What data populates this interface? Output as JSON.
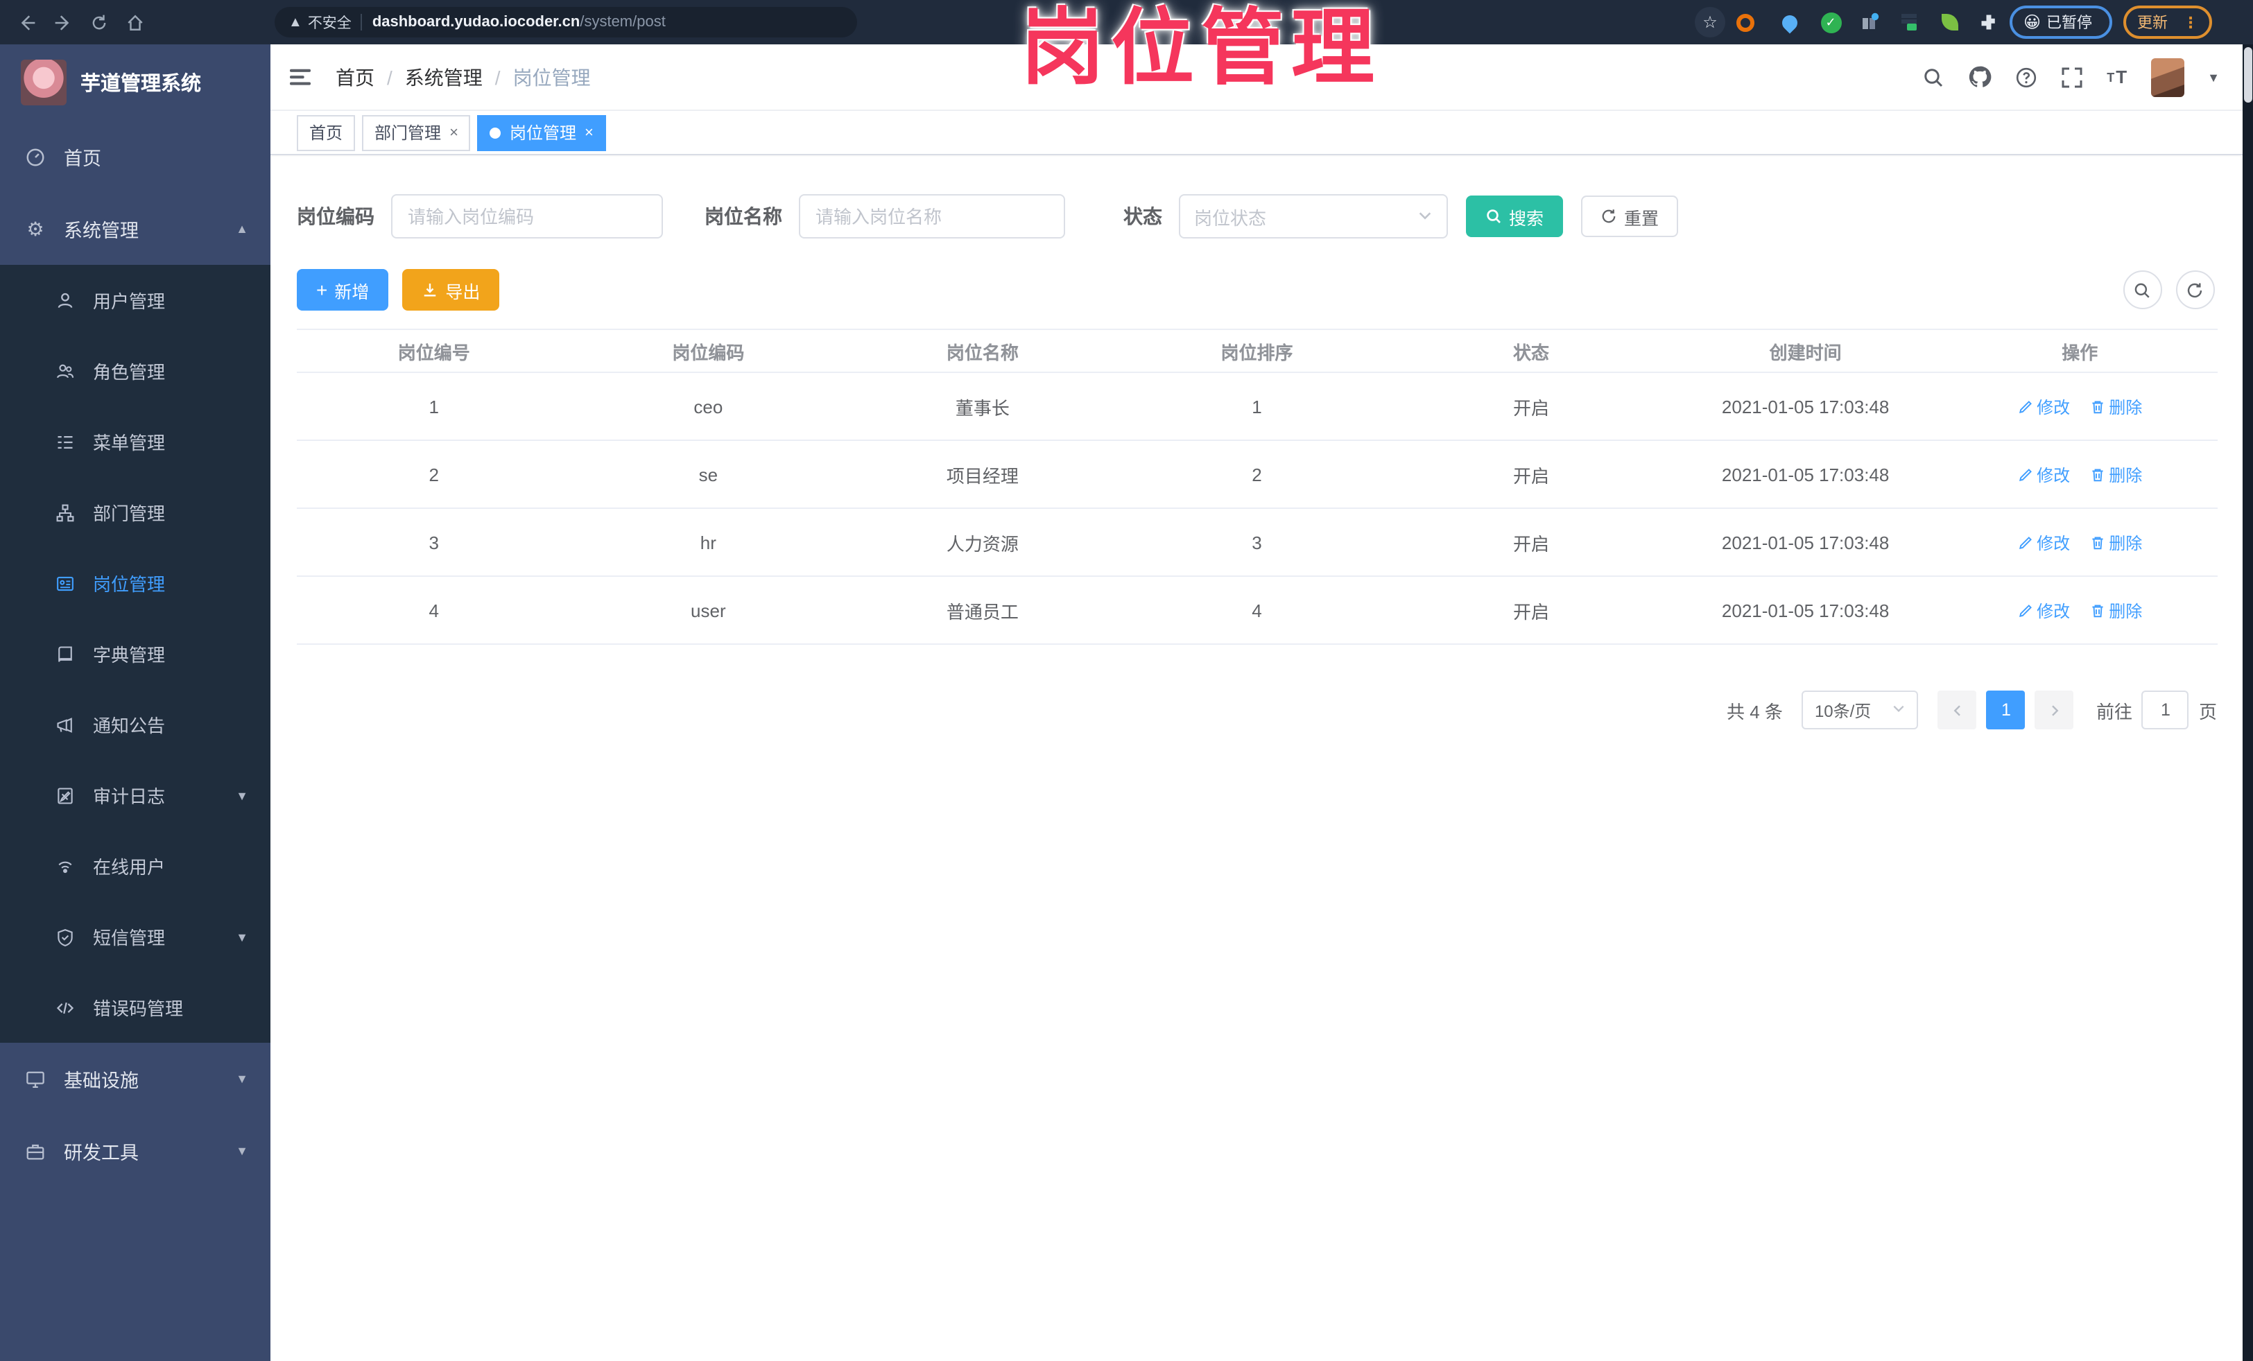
{
  "watermark": "岗位管理",
  "browser": {
    "security_label": "不安全",
    "url_host": "dashboard.yudao.iocoder.cn",
    "url_path": "/system/post",
    "profile_status": "已暂停",
    "profile_emoji": "😀",
    "update_label": "更新",
    "menu_dots": "⋮"
  },
  "sidebar": {
    "logo_title": "芋道管理系统",
    "menu": [
      {
        "label": "首页"
      },
      {
        "label": "系统管理"
      },
      {
        "label": "用户管理"
      },
      {
        "label": "角色管理"
      },
      {
        "label": "菜单管理"
      },
      {
        "label": "部门管理"
      },
      {
        "label": "岗位管理"
      },
      {
        "label": "字典管理"
      },
      {
        "label": "通知公告"
      },
      {
        "label": "审计日志"
      },
      {
        "label": "在线用户"
      },
      {
        "label": "短信管理"
      },
      {
        "label": "错误码管理"
      },
      {
        "label": "基础设施"
      },
      {
        "label": "研发工具"
      }
    ]
  },
  "header": {
    "breadcrumb": [
      "首页",
      "系统管理",
      "岗位管理"
    ],
    "separator": "/"
  },
  "tabs": [
    {
      "label": "首页"
    },
    {
      "label": "部门管理"
    },
    {
      "label": "岗位管理"
    }
  ],
  "filters": {
    "code_label": "岗位编码",
    "code_placeholder": "请输入岗位编码",
    "name_label": "岗位名称",
    "name_placeholder": "请输入岗位名称",
    "status_label": "状态",
    "status_placeholder": "岗位状态",
    "search_label": "搜索",
    "reset_label": "重置"
  },
  "toolbar": {
    "add_label": "新增",
    "export_label": "导出"
  },
  "table": {
    "columns": [
      "岗位编号",
      "岗位编码",
      "岗位名称",
      "岗位排序",
      "状态",
      "创建时间",
      "操作"
    ],
    "edit_label": "修改",
    "delete_label": "删除",
    "rows": [
      {
        "id": "1",
        "code": "ceo",
        "name": "董事长",
        "sort": "1",
        "status": "开启",
        "created_at": "2021-01-05 17:03:48"
      },
      {
        "id": "2",
        "code": "se",
        "name": "项目经理",
        "sort": "2",
        "status": "开启",
        "created_at": "2021-01-05 17:03:48"
      },
      {
        "id": "3",
        "code": "hr",
        "name": "人力资源",
        "sort": "3",
        "status": "开启",
        "created_at": "2021-01-05 17:03:48"
      },
      {
        "id": "4",
        "code": "user",
        "name": "普通员工",
        "sort": "4",
        "status": "开启",
        "created_at": "2021-01-05 17:03:48"
      }
    ]
  },
  "pagination": {
    "total_text": "共 4 条",
    "page_size_text": "10条/页",
    "page": "1",
    "prev": "‹",
    "next": "›",
    "goto_label": "前往",
    "goto_value": "1",
    "page_unit": "页"
  },
  "colors": {
    "primary": "#409eff",
    "search_teal": "#2cc0a5",
    "export_orange": "#f2a41b",
    "watermark_pink": "#f5365c",
    "sidebar_light": "#3a496c",
    "sidebar_dark": "#1f2d3d",
    "browser_bar": "#202b3c"
  }
}
